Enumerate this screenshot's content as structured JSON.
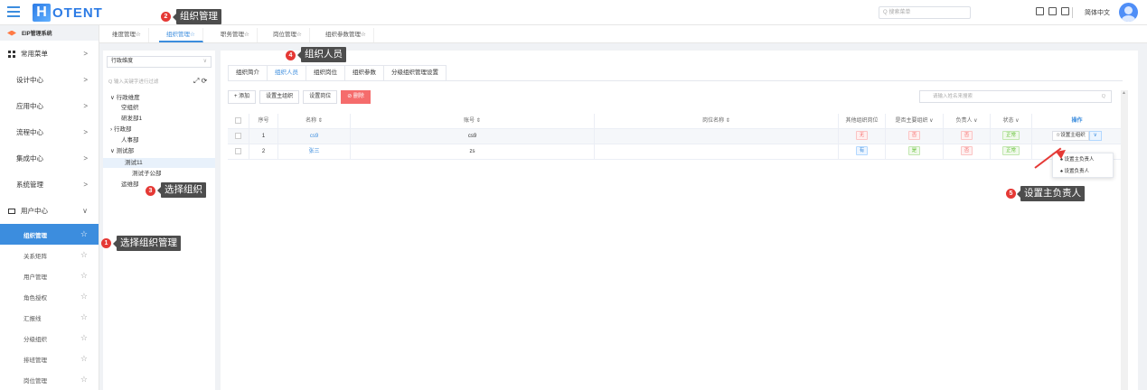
{
  "topbar": {
    "logo_mark": "H",
    "logo_text": "OTENT",
    "search_placeholder": "搜索菜单",
    "language": "简体中文"
  },
  "sidenav": {
    "system": "EIP管理系统",
    "common_menu": "常用菜单",
    "items": [
      "设计中心",
      "应用中心",
      "流程中心",
      "集成中心",
      "系统管理"
    ],
    "user_center": "用户中心",
    "sub_items": [
      "组织管理",
      "关系矩阵",
      "用户管理",
      "角色授权",
      "汇报线",
      "分级组织",
      "排班管理",
      "岗位管理"
    ],
    "chevron_right": ">",
    "chevron_down": "∨",
    "star": "☆"
  },
  "tabs": [
    "维度管理☆",
    "组织管理☆",
    "职务管理☆",
    "岗位管理☆",
    "组织参数管理☆"
  ],
  "tree": {
    "dimension": "行政维度",
    "search_placeholder": "输入关键字进行过滤",
    "nodes": [
      {
        "label": "∨ 行政维度",
        "indent": 0
      },
      {
        "label": "空组织",
        "indent": 1
      },
      {
        "label": "研发部1",
        "indent": 1
      },
      {
        "label": "› 行政部",
        "indent": 0
      },
      {
        "label": "人事部",
        "indent": 1
      },
      {
        "label": "∨ 测试部",
        "indent": 0
      },
      {
        "label": "测试11",
        "indent": 2
      },
      {
        "label": "测试子公部",
        "indent": 2
      },
      {
        "label": "运维部",
        "indent": 1
      }
    ]
  },
  "main": {
    "subtabs": [
      "组织简介",
      "组织人员",
      "组织岗位",
      "组织参数",
      "分级组织管理设置"
    ],
    "buttons": {
      "add": "+ 添加",
      "set_main_org": "设置主组织",
      "set_post": "设置岗位",
      "delete": "⊘ 删除"
    },
    "name_search_placeholder": "请输入姓名来搜索",
    "columns": [
      "序号",
      "名称 ⇕",
      "账号 ⇕",
      "岗位名称 ⇕",
      "其他组织岗位",
      "是否主要组织 ∨",
      "负责人 ∨",
      "状态 ∨",
      "操作"
    ],
    "rows": [
      {
        "index": "1",
        "name": "cs9",
        "account": "cs9",
        "post": "",
        "other": "无",
        "main_org": "否",
        "leader": "否",
        "status": "正常",
        "op": "☆设置主组织"
      },
      {
        "index": "2",
        "name": "张三",
        "account": "zs",
        "post": "",
        "other": "有",
        "main_org": "是",
        "leader": "否",
        "status": "正常",
        "op": ""
      }
    ],
    "dropdown": [
      "♠ 设置主负责人",
      "♠ 设置负责人"
    ],
    "dropdown_arrow": "∨"
  },
  "annotations": {
    "a1": {
      "num": "1",
      "text": "选择组织管理"
    },
    "a2": {
      "num": "2",
      "text": "组织管理"
    },
    "a3": {
      "num": "3",
      "text": "选择组织"
    },
    "a4": {
      "num": "4",
      "text": "组织人员"
    },
    "a5": {
      "num": "5",
      "text": "设置主负责人"
    }
  },
  "colors": {
    "accent": "#3c8dde",
    "danger": "#f56c6c",
    "annotation": "#e53935"
  }
}
